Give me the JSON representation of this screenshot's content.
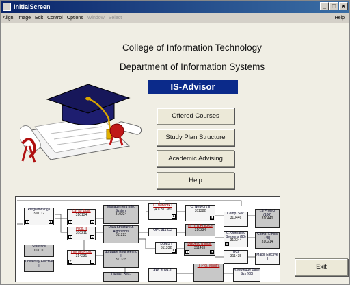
{
  "window": {
    "title": "InitialScreen",
    "controls": [
      "_",
      "□",
      "×"
    ]
  },
  "menu": {
    "items": [
      {
        "label": "Align",
        "enabled": true
      },
      {
        "label": "Image",
        "enabled": true
      },
      {
        "label": "Edit",
        "enabled": true
      },
      {
        "label": "Control",
        "enabled": true
      },
      {
        "label": "Options",
        "enabled": true
      },
      {
        "label": "Window",
        "enabled": false
      },
      {
        "label": "Select",
        "enabled": false
      }
    ],
    "help": "Help"
  },
  "header": {
    "college": "College of Information Technology",
    "department": "Department of Information Systems",
    "app_name": "IS-Advisor"
  },
  "actions": {
    "offered_courses": "Offered Courses",
    "study_plan": "Study Plan Structure",
    "academic_advising": "Academic Advising",
    "help": "Help",
    "exit": "Exit"
  },
  "colors": {
    "brand_bg": "#0b2a8a",
    "title_bar": "#0a246a"
  },
  "study_plan_chart": {
    "courses": [
      {
        "name": "Programming I",
        "code": "310112",
        "marks": [
          "T",
          "L"
        ]
      },
      {
        "name": "I.S. for Busi.",
        "code": "310134",
        "marks": [
          "T",
          "L"
        ],
        "red": true
      },
      {
        "name": "Management Info. System",
        "code": "310234",
        "shaded": true
      },
      {
        "name": "C. Network I",
        "code": "(40) 311381",
        "marks": [
          "L"
        ],
        "red": true
      },
      {
        "name": "C. Network II",
        "code": "311382",
        "marks": [
          "L"
        ]
      },
      {
        "name": "Comp. Sec.",
        "code": "310446"
      },
      {
        "name": "I.S Project (100)",
        "code": "310440"
      },
      {
        "name": "Prog. II",
        "code": "310211",
        "marks": [
          "T",
          "L"
        ],
        "red": true
      },
      {
        "name": "Data Structure & Algorithms",
        "code": "311223",
        "shaded": true
      },
      {
        "name": "OPL",
        "code": "311422"
      },
      {
        "name": "IT Th & Practice",
        "code": "310334",
        "red": true
      },
      {
        "name": "C. Operating Systems (60)",
        "code": "310344",
        "marks": [
          "T"
        ]
      },
      {
        "name": "Comp. Ethics (45)",
        "code": "310214",
        "shaded": true
      },
      {
        "name": "Statistics",
        "code": "103110",
        "shaded": true
      },
      {
        "name": "Internet Prog.",
        "code": "314231",
        "marks": [
          "T",
          "L"
        ],
        "red": true
      },
      {
        "name": "DBMS I",
        "code": "311332",
        "marks": [
          "L"
        ]
      },
      {
        "name": "DBDesc & Impl.",
        "code": "311463",
        "marks": [
          "T",
          "L"
        ],
        "red": true
      },
      {
        "name": "HCI",
        "code": "311435"
      },
      {
        "name": "Major Elective II",
        "code": ""
      },
      {
        "name": "University Elective I",
        "code": "",
        "shaded": true
      },
      {
        "name": "Software Engineering I",
        "code": "311335",
        "shaded": true
      },
      {
        "name": "Human Res.",
        "code": ""
      },
      {
        "name": "SW. Engg. II",
        "code": ""
      },
      {
        "name": "IT Proj. Mngmt",
        "code": "",
        "red": true
      },
      {
        "name": "Knowledge Base Sys (60)",
        "code": ""
      }
    ]
  }
}
